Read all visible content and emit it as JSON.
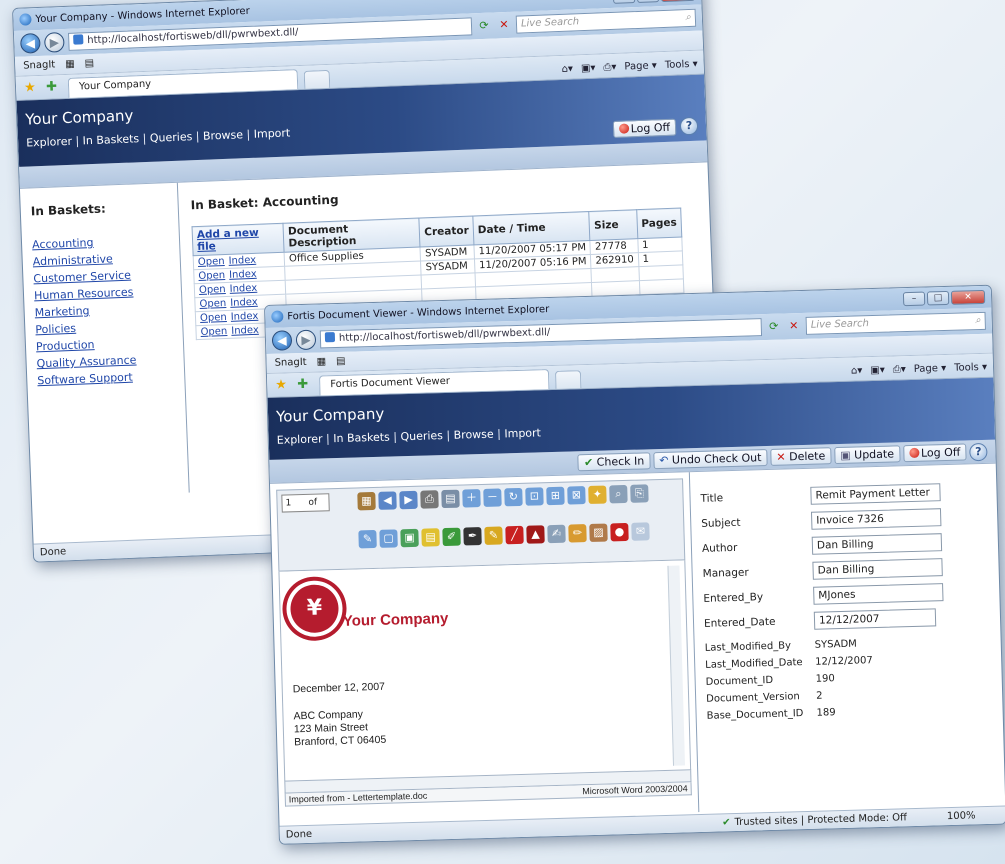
{
  "window1": {
    "title": "Your Company - Windows Internet Explorer",
    "url": "http://localhost/fortisweb/dll/pwrwbext.dll/",
    "search_placeholder": "Live Search",
    "links": {
      "snagit": "SnagIt"
    },
    "tab": "Your Company",
    "cmd": {
      "page": "Page ▾",
      "tools": "Tools ▾"
    },
    "banner": {
      "company": "Your Company",
      "nav": [
        "Explorer",
        "In Baskets",
        "Queries",
        "Browse",
        "Import"
      ],
      "logoff": "Log Off"
    },
    "sidebar": {
      "heading": "In Baskets:",
      "items": [
        "Accounting",
        "Administrative",
        "Customer Service",
        "Human Resources",
        "Marketing",
        "Policies",
        "Production",
        "Quality Assurance",
        "Software Support"
      ]
    },
    "main": {
      "heading": "In Basket:  Accounting",
      "columns": [
        "Add a new file",
        "Document Description",
        "Creator",
        "Date / Time",
        "Size",
        "Pages"
      ],
      "row_links": {
        "open": "Open",
        "index": "Index"
      },
      "rows": [
        {
          "desc": "Office Supplies",
          "creator": "SYSADM",
          "date": "11/20/2007 05:17 PM",
          "size": "27778",
          "pages": "1"
        },
        {
          "desc": "",
          "creator": "SYSADM",
          "date": "11/20/2007 05:16 PM",
          "size": "262910",
          "pages": "1"
        },
        {
          "desc": "",
          "creator": "",
          "date": "",
          "size": "",
          "pages": ""
        },
        {
          "desc": "",
          "creator": "",
          "date": "",
          "size": "",
          "pages": ""
        },
        {
          "desc": "",
          "creator": "",
          "date": "",
          "size": "",
          "pages": ""
        },
        {
          "desc": "",
          "creator": "",
          "date": "",
          "size": "",
          "pages": ""
        }
      ]
    },
    "status": "Done"
  },
  "window2": {
    "title": "Fortis Document Viewer - Windows Internet Explorer",
    "url": "http://localhost/fortisweb/dll/pwrwbext.dll/",
    "search_placeholder": "Live Search",
    "links": {
      "snagit": "SnagIt"
    },
    "tab": "Fortis Document Viewer",
    "cmd": {
      "page": "Page ▾",
      "tools": "Tools ▾"
    },
    "banner": {
      "company": "Your Company",
      "nav": [
        "Explorer",
        "In Baskets",
        "Queries",
        "Browse",
        "Import"
      ]
    },
    "actions": {
      "checkin": "Check In",
      "undo": "Undo Check Out",
      "delete": "Delete",
      "update": "Update",
      "logoff": "Log Off"
    },
    "viewer": {
      "page_num": "1",
      "page_of": "of",
      "logo_text": "Your Company",
      "logo_symbol": "¥",
      "date": "December 12, 2007",
      "address": [
        "ABC Company",
        "123 Main Street",
        "Branford, CT 06405"
      ],
      "status_left": "Imported from - Lettertemplate.doc",
      "status_right": "Microsoft Word 2003/2004"
    },
    "fields": [
      {
        "label": "Title",
        "value": "Remit Payment Letter"
      },
      {
        "label": "Subject",
        "value": "Invoice 7326"
      },
      {
        "label": "Author",
        "value": "Dan Billing"
      },
      {
        "label": "Manager",
        "value": "Dan Billing"
      },
      {
        "label": "Entered_By",
        "value": "MJones"
      },
      {
        "label": "Entered_Date",
        "value": "12/12/2007"
      }
    ],
    "readonly": [
      {
        "label": "Last_Modified_By",
        "value": "SYSADM"
      },
      {
        "label": "Last_Modified_Date",
        "value": "12/12/2007"
      },
      {
        "label": "Document_ID",
        "value": "190"
      },
      {
        "label": "Document_Version",
        "value": "2"
      },
      {
        "label": "Base_Document_ID",
        "value": "189"
      }
    ],
    "status": "Done",
    "status_right": "Trusted sites | Protected Mode: Off",
    "zoom": "100%"
  },
  "colors": {
    "banner": "#1a2f5c",
    "link": "#1f46a8",
    "brand_red": "#b51c2e"
  }
}
